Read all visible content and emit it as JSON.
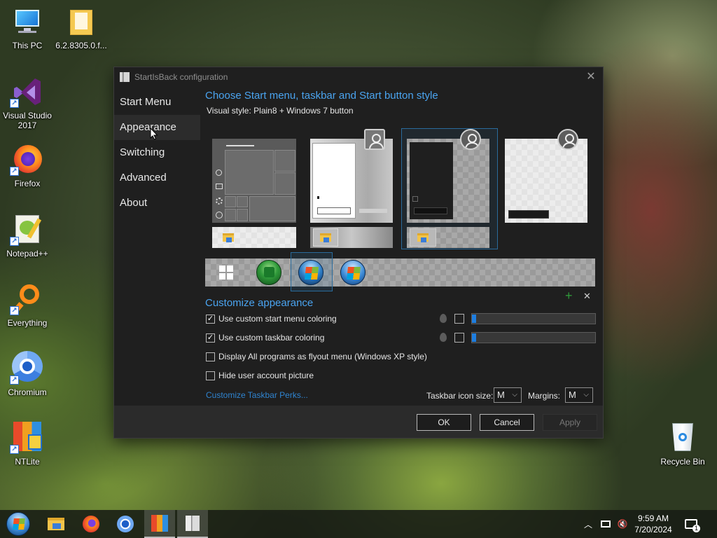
{
  "desktop": {
    "icons": [
      {
        "label": "This PC",
        "icon": "computer-icon"
      },
      {
        "label": "6.2.8305.0.f...",
        "icon": "folder-icon"
      },
      {
        "label": "Visual Studio 2017",
        "icon": "visual-studio-icon"
      },
      {
        "label": "Firefox",
        "icon": "firefox-icon"
      },
      {
        "label": "Notepad++",
        "icon": "notepad-plus-plus-icon"
      },
      {
        "label": "Everything",
        "icon": "everything-search-icon"
      },
      {
        "label": "Chromium",
        "icon": "chromium-icon"
      },
      {
        "label": "NTLite",
        "icon": "ntlite-icon"
      },
      {
        "label": "Recycle Bin",
        "icon": "recycle-bin-icon"
      }
    ]
  },
  "window": {
    "title": "StartIsBack configuration",
    "nav": [
      "Start Menu",
      "Appearance",
      "Switching",
      "Advanced",
      "About"
    ],
    "active_nav": "Appearance",
    "style_heading": "Choose Start menu, taskbar and Start button style",
    "visual_style": "Visual style:  Plain8 + Windows 7 button",
    "customize_heading": "Customize appearance",
    "options": [
      {
        "label": "Use custom start menu coloring",
        "checked": true
      },
      {
        "label": "Use custom taskbar coloring",
        "checked": true
      },
      {
        "label": "Display All programs as flyout menu (Windows XP style)",
        "checked": false
      },
      {
        "label": "Hide user account picture",
        "checked": false
      }
    ],
    "link": "Customize Taskbar Perks...",
    "icon_size_label": "Taskbar icon size:",
    "icon_size_value": "M",
    "margins_label": "Margins:",
    "margins_value": "M",
    "buttons": {
      "ok": "OK",
      "cancel": "Cancel",
      "apply": "Apply"
    },
    "add_symbol": "+",
    "remove_symbol": "✕",
    "selected_style_index": 2,
    "selected_orb_index": 2,
    "start_menu_slider": 0,
    "taskbar_slider": 0
  },
  "taskbar": {
    "pinned": [
      "windows-start-orb",
      "file-explorer-icon",
      "firefox-icon",
      "chromium-icon",
      "ntlite-icon",
      "startisback-config-icon"
    ],
    "time": "9:59 AM",
    "date": "7/20/2024",
    "notification_count": "1"
  },
  "colors": {
    "accent": "#4aa4f0",
    "selection_border": "#2a6b9c",
    "slider_thumb": "#1e7ee0"
  }
}
